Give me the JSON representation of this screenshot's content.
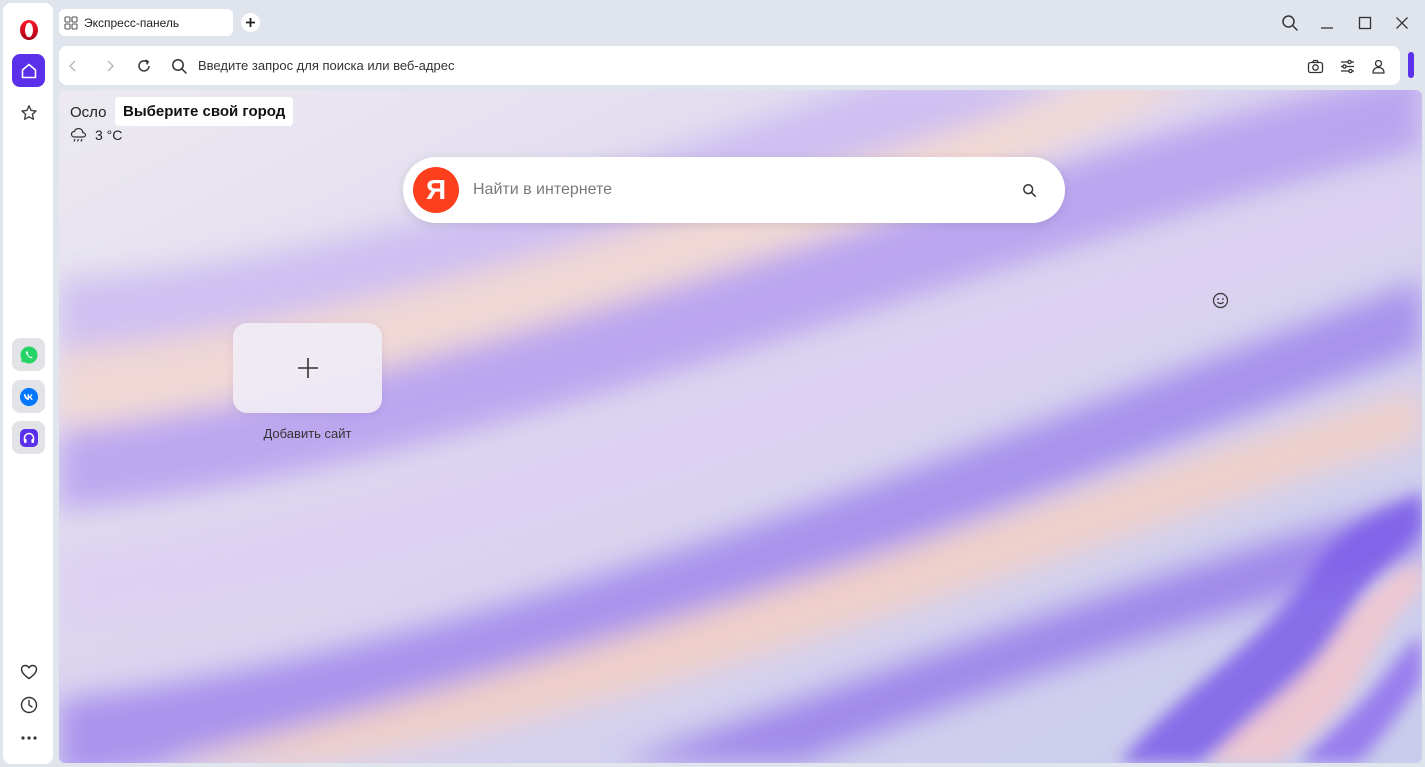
{
  "browser": {
    "tab": {
      "title": "Экспресс-панель",
      "icon": "grid-icon"
    },
    "new_tab_icon": "plus-icon",
    "window_controls": [
      "search-icon",
      "minimize-icon",
      "maximize-icon",
      "close-icon"
    ],
    "address_bar": {
      "placeholder": "Введите запрос для поиска или веб-адрес",
      "right_icons": [
        "camera-icon",
        "settings-sliders-icon",
        "profile-icon"
      ]
    },
    "accent_color": "#5b30ea"
  },
  "sidebar": {
    "top": [
      "opera-logo",
      "home-icon",
      "star-icon"
    ],
    "apps": [
      "whatsapp-icon",
      "vk-icon",
      "music-player-icon"
    ],
    "bottom": [
      "heart-icon",
      "history-icon",
      "more-icon"
    ]
  },
  "speed_dial": {
    "weather": {
      "city": "Осло",
      "choose_city_label": "Выберите свой город",
      "temperature": "3 °C",
      "icon": "cloud-rain-icon"
    },
    "search": {
      "logo_letter": "Я",
      "placeholder": "Найти в интернете",
      "logo_color": "#fc3f1d"
    },
    "add_site_tile": {
      "label": "Добавить сайт",
      "icon": "plus-icon"
    },
    "emoji_icon": "smile-icon"
  }
}
